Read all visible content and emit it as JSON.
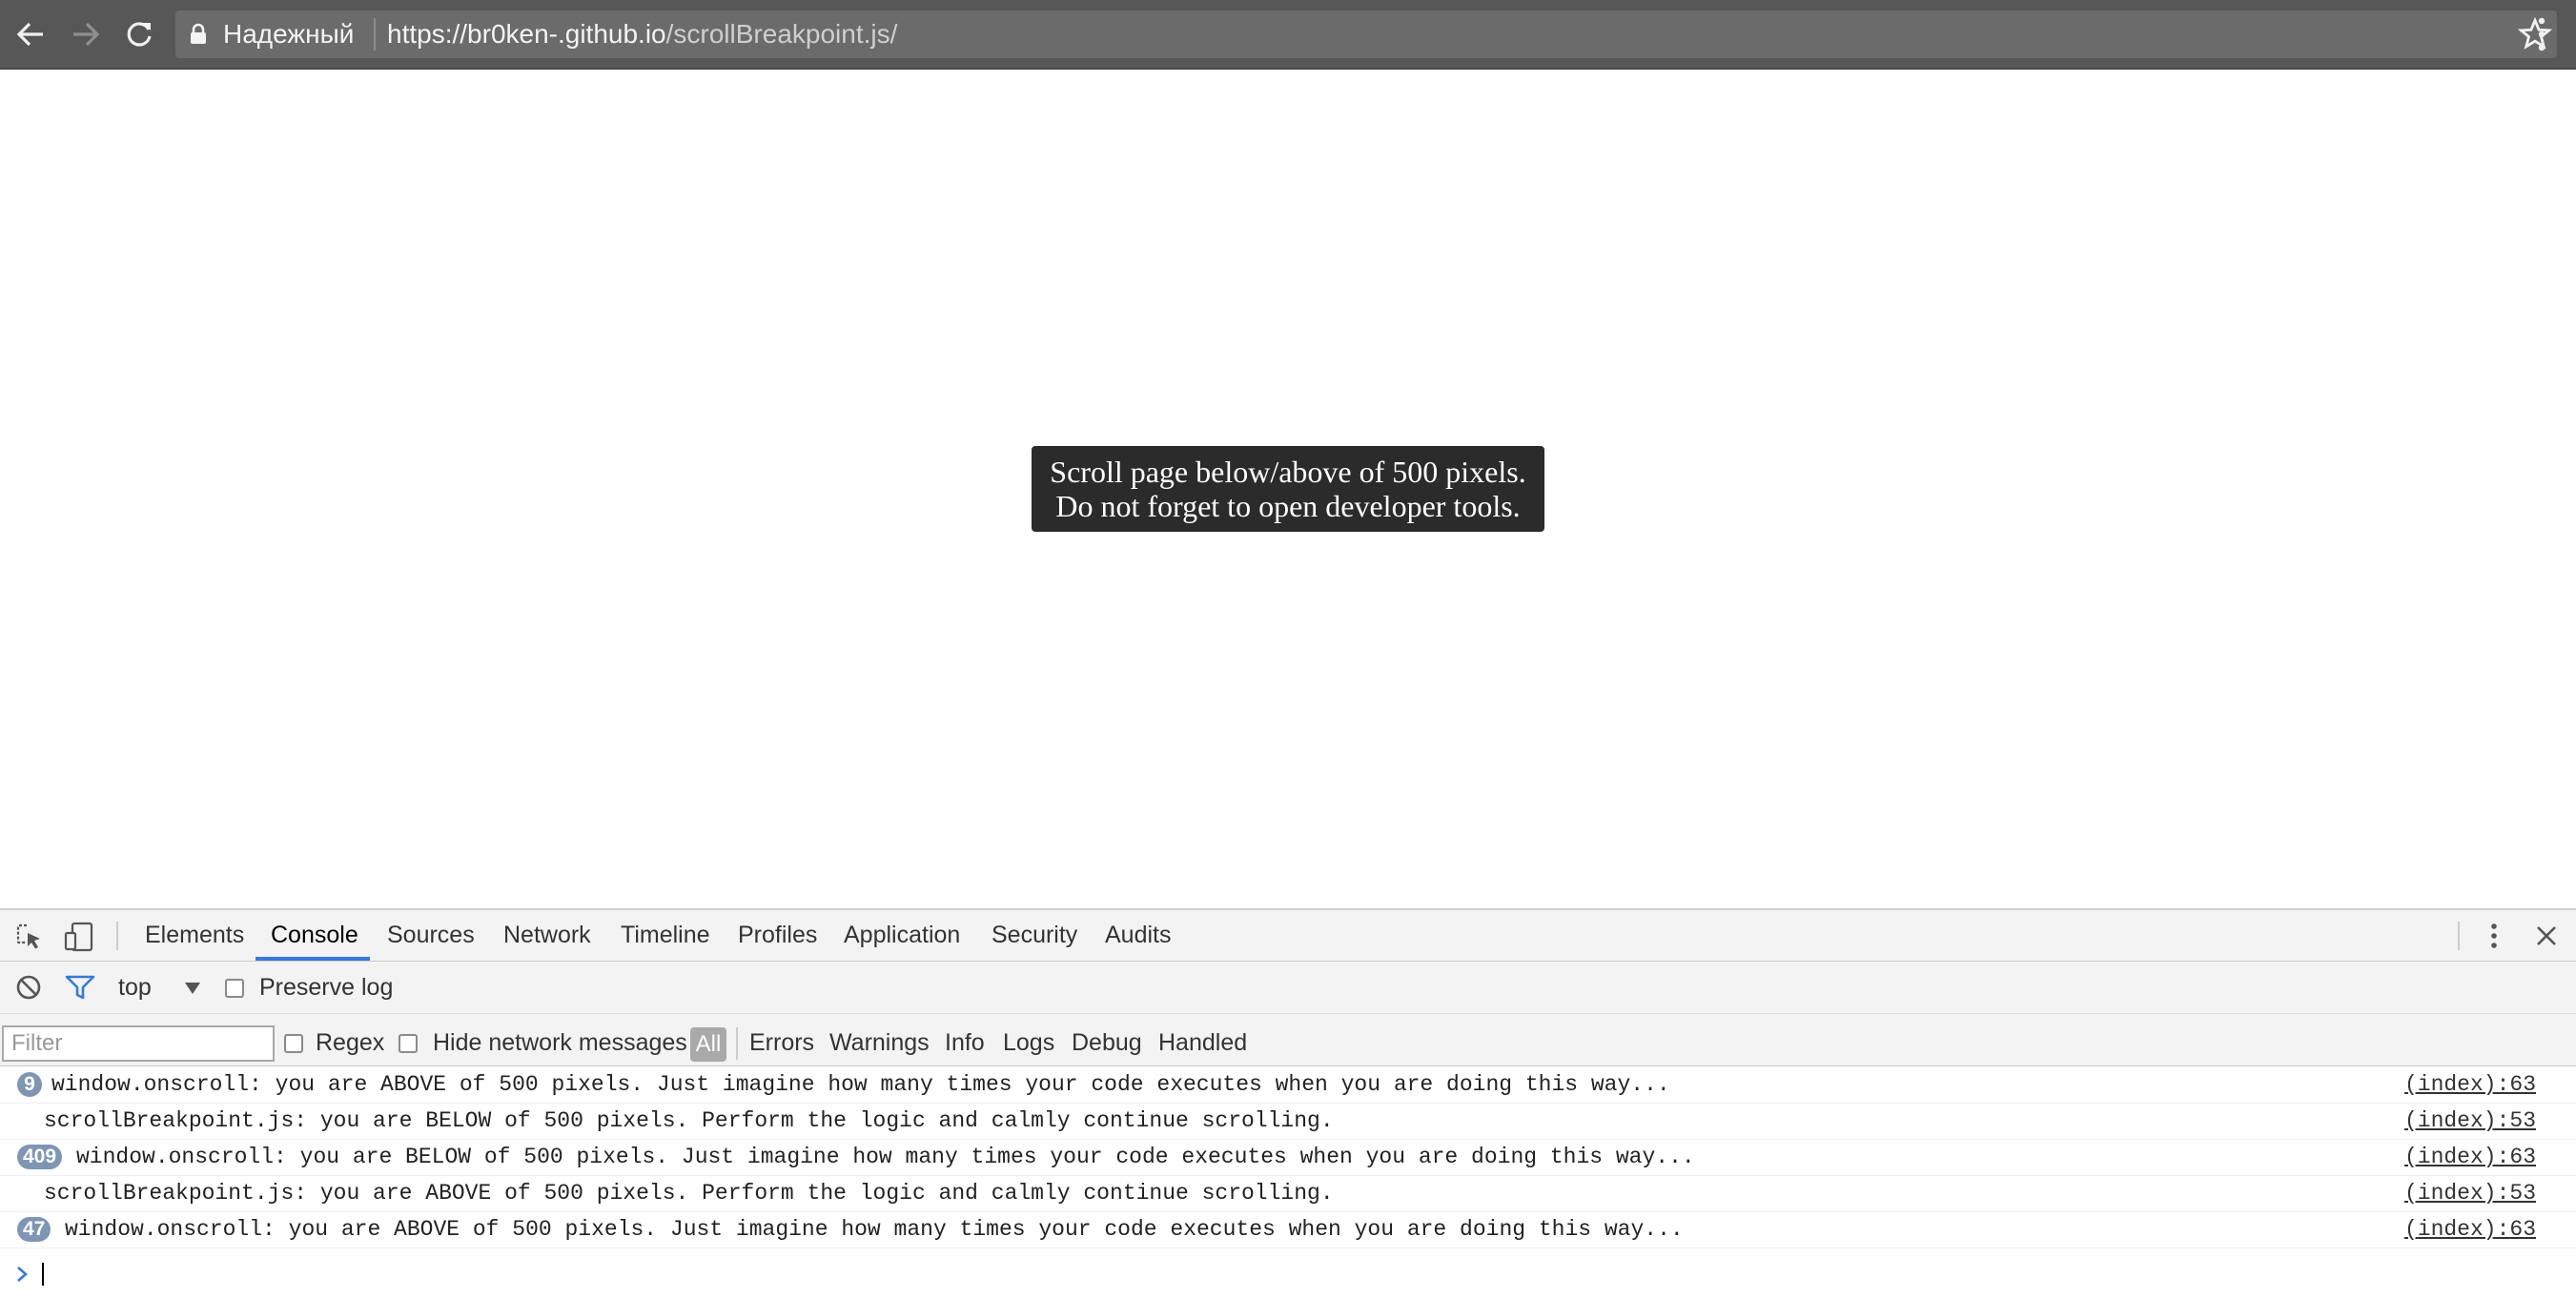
{
  "browser": {
    "secure_label": "Надежный",
    "url_host": "https://br0ken-.github.io",
    "url_path": "/scrollBreakpoint.js/"
  },
  "page": {
    "notice_line1": "Scroll page below/above of 500 pixels.",
    "notice_line2": "Do not forget to open developer tools."
  },
  "devtools": {
    "tabs": [
      "Elements",
      "Console",
      "Sources",
      "Network",
      "Timeline",
      "Profiles",
      "Application",
      "Security",
      "Audits"
    ],
    "active_tab": "Console",
    "context": "top",
    "preserve_log_label": "Preserve log",
    "filter_placeholder": "Filter",
    "regex_label": "Regex",
    "hide_network_label": "Hide network messages",
    "levels": [
      "All",
      "Errors",
      "Warnings",
      "Info",
      "Logs",
      "Debug",
      "Handled"
    ],
    "console_rows": [
      {
        "count": "9",
        "message": "window.onscroll: you are ABOVE of 500 pixels. Just imagine how many times your code executes when you are doing this way...",
        "source": "(index):63"
      },
      {
        "count": "",
        "message": "scrollBreakpoint.js: you are BELOW of 500 pixels. Perform the logic and calmly continue scrolling.",
        "source": "(index):53"
      },
      {
        "count": "409",
        "message": "window.onscroll: you are BELOW of 500 pixels. Just imagine how many times your code executes when you are doing this way...",
        "source": "(index):63"
      },
      {
        "count": "",
        "message": "scrollBreakpoint.js: you are ABOVE of 500 pixels. Perform the logic and calmly continue scrolling.",
        "source": "(index):53"
      },
      {
        "count": "47",
        "message": "window.onscroll: you are ABOVE of 500 pixels. Just imagine how many times your code executes when you are doing this way...",
        "source": "(index):63"
      }
    ]
  },
  "colors": {
    "chrome_bg": "#575757",
    "omnibox_bg": "#6b6b6b",
    "active_tab_underline": "#3879d9",
    "badge_bg": "#7e96b4",
    "notice_bg": "#2b2b2b"
  }
}
